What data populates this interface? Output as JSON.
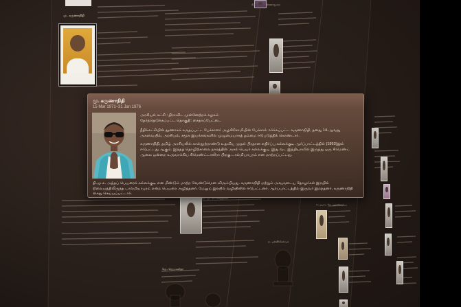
{
  "popup": {
    "name": "மு. கருணாநிதி",
    "dates": "15 Mar 1971–31 Jan 1976",
    "party": "அரசியல் கட்சி : திராவிட முன்னேற்றக் கழகம்",
    "constituency": "தேர்ந்தெடுக்கப்பட்ட தொகுதி: சைதாப்பேட்டை",
    "bio_1": "நீதிக்கட்சியின் தூணாகக் கருதப்பட்ட பேச்சாளர் அழகிரிசாமியின் பேச்சால் ஈர்க்கப்பட்ட கருணாநிதி, தனது 14-ஆவது அகவையில், அரசியல், சமூக இயக்கங்களில் முழுமையாகத் தம்மை ஈடுபடுத்திக் கொண்டார்.",
    "bio_2": "கருணாநிதி, தமிழ் அரசியலில் கால்நூற்றாண்டு உதவிய முதல் பிரதான எதிர்ப்பு கல்லக்குடி ஆர்ப்பாட்டத்தில் (1953)இல் ஈடுபட்டது ஆகும். இந்தத் தொழிற்சாலை நகரத்தின் அசல் பெயர் கல்லக்குடி. இது வட இந்தியாவில் இருந்து ஒரு சிமெண்ட் ஆலை ஒன்றை உருவாக்கிய சிமெண்ட்டாலிரா பிறகு டால்மியாபுரம் என மாற்றப்பட்டது.",
    "bio_3": "தி.மு.க. அந்தப் பெயரைக் கல்லக்குடி என மீண்டும் மாற்ற வேண்டுமென விரும்பியது. கருணாநிதி மற்றும் அவருடைய தோழர்கள் இரயில் நிலையத்திலிருந்த டால்மியாபுரம் என்ற பெயரை அழித்தனர். மேலும் இரயில் வழியினில் ஈடுபட்டனர். ஆர்ப்பாட்டத்தில் இருவர் இறந்தனர், கருணாநிதி கைது செய்யப்பட்டார்."
  },
  "background": {
    "headings": [
      "மு. கருணாநிதி",
      "சி. என். அண்ணாதுரை",
      "எம். ஜி. ராமச்சந்திரன்",
      "ஜெ. ஜெயலலிதா",
      "எடப்பாடி கே. பழனிசாமி",
      "ஓ. பன்னீர்செல்வம்"
    ]
  },
  "colors": {
    "background": "#2b211c",
    "popup_header": "#805f50",
    "popup_body": "#3a2a22",
    "text": "#efe2d6"
  }
}
